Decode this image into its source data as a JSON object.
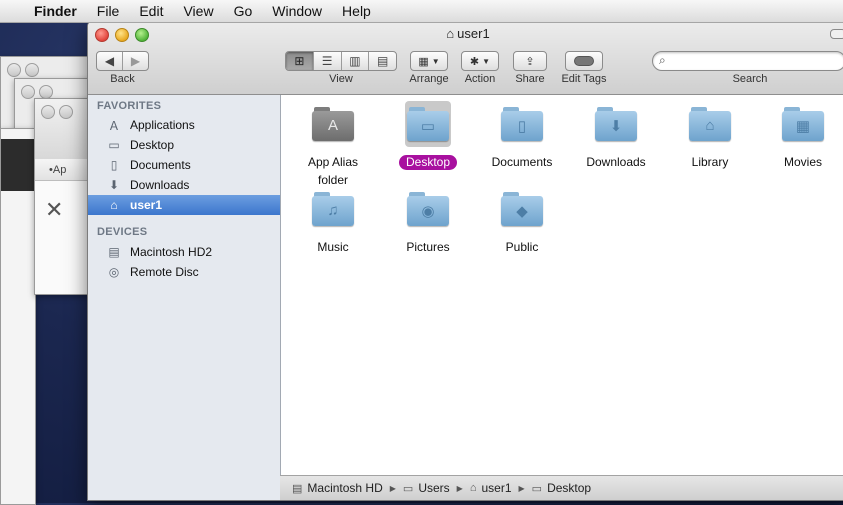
{
  "menubar": {
    "app": "Finder",
    "items": [
      "File",
      "Edit",
      "View",
      "Go",
      "Window",
      "Help"
    ]
  },
  "window": {
    "title": "user1"
  },
  "toolbar": {
    "back_label": "Back",
    "view_label": "View",
    "arrange_label": "Arrange",
    "action_label": "Action",
    "share_label": "Share",
    "edit_tags_label": "Edit Tags",
    "search_label": "Search",
    "search_placeholder": ""
  },
  "background_window": {
    "partial_label": "•Ap"
  },
  "sidebar": {
    "favorites_header": "FAVORITES",
    "favorites": [
      {
        "label": "Applications",
        "icon": "applications-icon"
      },
      {
        "label": "Desktop",
        "icon": "desktop-icon"
      },
      {
        "label": "Documents",
        "icon": "documents-icon"
      },
      {
        "label": "Downloads",
        "icon": "downloads-icon"
      },
      {
        "label": "user1",
        "icon": "home-icon",
        "selected": true
      }
    ],
    "devices_header": "DEVICES",
    "devices": [
      {
        "label": "Macintosh HD2",
        "icon": "hard-drive-icon"
      },
      {
        "label": "Remote Disc",
        "icon": "disc-icon"
      }
    ]
  },
  "content": {
    "items": [
      {
        "label_line1": "App Alias",
        "label_line2": "folder",
        "icon": "app-alias-folder-icon"
      },
      {
        "label_line1": "Desktop",
        "icon": "desktop-folder-icon",
        "selected": true
      },
      {
        "label_line1": "Documents",
        "icon": "documents-folder-icon"
      },
      {
        "label_line1": "Downloads",
        "icon": "downloads-folder-icon"
      },
      {
        "label_line1": "Library",
        "icon": "library-folder-icon"
      },
      {
        "label_line1": "Movies",
        "icon": "movies-folder-icon"
      },
      {
        "label_line1": "Music",
        "icon": "music-folder-icon"
      },
      {
        "label_line1": "Pictures",
        "icon": "pictures-folder-icon"
      },
      {
        "label_line1": "Public",
        "icon": "public-folder-icon"
      }
    ]
  },
  "pathbar": {
    "segments": [
      "Macintosh HD",
      "Users",
      "user1",
      "Desktop"
    ]
  },
  "colors": {
    "selection_label": "#a8109f",
    "sidebar_selection": "#3c76cd",
    "folder_blue": "#6ea3cd"
  }
}
